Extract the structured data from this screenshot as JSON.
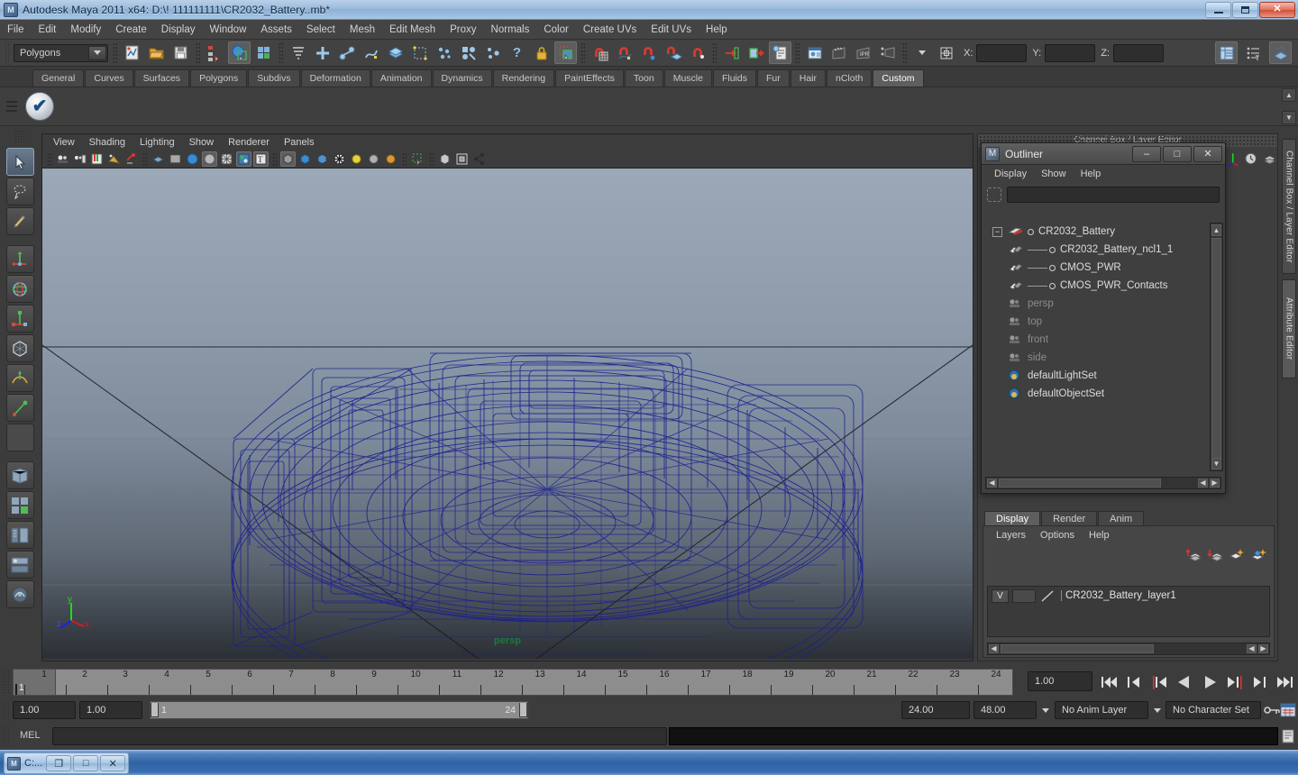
{
  "window": {
    "title": "Autodesk Maya 2011 x64: D:\\! 111111111\\CR2032_Battery..mb*",
    "app_icon": "maya-icon",
    "minimize": "–",
    "maximize": "□",
    "close": "✕"
  },
  "menubar": {
    "items": [
      "File",
      "Edit",
      "Modify",
      "Create",
      "Display",
      "Window",
      "Assets",
      "Select",
      "Mesh",
      "Edit Mesh",
      "Proxy",
      "Normals",
      "Color",
      "Create UVs",
      "Edit UVs",
      "Help"
    ]
  },
  "statusline": {
    "mode": "Polygons",
    "coord_labels": [
      "X:",
      "Y:",
      "Z:"
    ],
    "coord_values": [
      "",
      "",
      ""
    ]
  },
  "shelf": {
    "tabs": [
      "General",
      "Curves",
      "Surfaces",
      "Polygons",
      "Subdivs",
      "Deformation",
      "Animation",
      "Dynamics",
      "Rendering",
      "PaintEffects",
      "Toon",
      "Muscle",
      "Fluids",
      "Fur",
      "Hair",
      "nCloth",
      "Custom"
    ],
    "active_tab": "Custom",
    "item_icon": "checkmark-shelf-icon"
  },
  "viewport": {
    "menus": [
      "View",
      "Shading",
      "Lighting",
      "Show",
      "Renderer",
      "Panels"
    ],
    "camera_label": "persp",
    "axis": {
      "x": "x",
      "y": "y",
      "z": "z"
    },
    "bg_top": "#9aa8b8",
    "bg_bottom": "#2b2f35",
    "wireframe_color": "#1c1f8e",
    "model_name": "CR2032_Battery"
  },
  "outliner": {
    "title": "Outliner",
    "window_buttons": {
      "minimize": "–",
      "maximize": "□",
      "close": "✕"
    },
    "menus": [
      "Display",
      "Show",
      "Help"
    ],
    "search_value": "",
    "items": [
      {
        "label": "CR2032_Battery",
        "icon": "transform-icon",
        "level": 0,
        "expander": "−",
        "dim": false
      },
      {
        "label": "CR2032_Battery_ncl1_1",
        "icon": "mesh-icon",
        "level": 1,
        "expander": "",
        "dim": false
      },
      {
        "label": "CMOS_PWR",
        "icon": "mesh-icon",
        "level": 1,
        "expander": "",
        "dim": false
      },
      {
        "label": "CMOS_PWR_Contacts",
        "icon": "mesh-icon",
        "level": 1,
        "expander": "",
        "dim": false
      },
      {
        "label": "persp",
        "icon": "camera-icon",
        "level": 0,
        "expander": "",
        "dim": true
      },
      {
        "label": "top",
        "icon": "camera-icon",
        "level": 0,
        "expander": "",
        "dim": true
      },
      {
        "label": "front",
        "icon": "camera-icon",
        "level": 0,
        "expander": "",
        "dim": true
      },
      {
        "label": "side",
        "icon": "camera-icon",
        "level": 0,
        "expander": "",
        "dim": true
      },
      {
        "label": "defaultLightSet",
        "icon": "set-icon",
        "level": 0,
        "expander": "",
        "dim": false
      },
      {
        "label": "defaultObjectSet",
        "icon": "set-icon",
        "level": 0,
        "expander": "",
        "dim": false
      }
    ]
  },
  "channelbox": {
    "header": "Channel Box / Layer Editor"
  },
  "layer_editor": {
    "tabs": [
      "Display",
      "Render",
      "Anim"
    ],
    "active_tab": "Display",
    "menus": [
      "Layers",
      "Options",
      "Help"
    ],
    "tool_icons": [
      "layer-up-icon",
      "layer-down-icon",
      "new-layer-icon",
      "new-layer-from-selected-icon"
    ],
    "layers": [
      {
        "visibility": "V",
        "type_toggle": "",
        "name": "CR2032_Battery_layer1"
      }
    ]
  },
  "right_tabs": {
    "items": [
      "Channel Box / Layer Editor",
      "Attribute Editor"
    ],
    "selected": "Attribute Editor"
  },
  "timeline": {
    "ticks": [
      "1",
      "2",
      "3",
      "4",
      "5",
      "6",
      "7",
      "8",
      "9",
      "10",
      "11",
      "12",
      "13",
      "14",
      "15",
      "16",
      "17",
      "18",
      "19",
      "20",
      "21",
      "22",
      "23",
      "24"
    ],
    "current_frame_label": "1",
    "current_time": "1.00",
    "playback_buttons": [
      "go-to-start-icon",
      "step-back-keyframe-icon",
      "step-back-frame-icon",
      "play-backwards-icon",
      "play-forwards-icon",
      "step-forward-frame-icon",
      "step-forward-keyframe-icon",
      "go-to-end-icon"
    ]
  },
  "range_slider": {
    "anim_start": "1.00",
    "anim_end": "1.00",
    "range_start_label": "1",
    "range_end_label": "24",
    "playback_end": "24.00",
    "anim_end_total": "48.00",
    "anim_layer": "No Anim Layer",
    "character_set": "No Character Set",
    "key_icon": "auto-key-icon",
    "prefs_icon": "animation-preferences-icon"
  },
  "command_line": {
    "language_label": "MEL",
    "input_value": "",
    "output_value": "",
    "script_editor_icon": "script-editor-icon"
  },
  "taskbar": {
    "item_label": "C:...",
    "item_icon": "maya-icon",
    "buttons": [
      "restore-icon",
      "maximize-icon",
      "close-icon"
    ],
    "restore": "❐",
    "maximize": "□",
    "close": "✕"
  }
}
